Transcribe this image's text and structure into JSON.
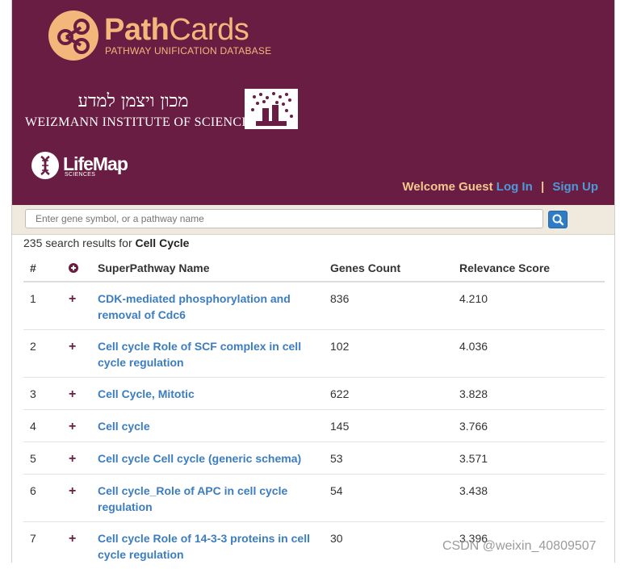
{
  "brand": {
    "name_bold": "Path",
    "name_light": "Cards",
    "subtitle": "PATHWAY UNIFICATION DATABASE",
    "accent_color": "#f3b77c",
    "header_bg": "#6a1d42"
  },
  "institute": {
    "hebrew_name": "מכון ויצמן למדע",
    "english_name": "WEIZMANN INSTITUTE OF SCIENCE"
  },
  "partner": {
    "name": "LifeMap",
    "subtitle": "SCIENCES"
  },
  "account": {
    "welcome": "Welcome Guest",
    "login": "Log In",
    "separator": "|",
    "signup": "Sign Up"
  },
  "search": {
    "placeholder": "Enter gene symbol, or a pathway name",
    "button_icon": "search-icon"
  },
  "results": {
    "prefix": "235 search results for",
    "query": "Cell Cycle",
    "columns": {
      "num": "#",
      "expand_icon": "plus-circle-icon",
      "name": "SuperPathway Name",
      "genes": "Genes Count",
      "score": "Relevance Score"
    },
    "rows": [
      {
        "num": "1",
        "name": "CDK-mediated phosphorylation and removal of Cdc6",
        "genes": "836",
        "score": "4.210"
      },
      {
        "num": "2",
        "name": "Cell cycle Role of SCF complex in cell cycle regulation",
        "genes": "102",
        "score": "4.036"
      },
      {
        "num": "3",
        "name": "Cell Cycle, Mitotic",
        "genes": "622",
        "score": "3.828"
      },
      {
        "num": "4",
        "name": "Cell cycle",
        "genes": "145",
        "score": "3.766"
      },
      {
        "num": "5",
        "name": "Cell cycle Cell cycle (generic schema)",
        "genes": "53",
        "score": "3.571"
      },
      {
        "num": "6",
        "name": "Cell cycle_Role of APC in cell cycle regulation",
        "genes": "54",
        "score": "3.438"
      },
      {
        "num": "7",
        "name": "Cell cycle Role of 14-3-3 proteins in cell cycle regulation",
        "genes": "30",
        "score": "3.396"
      }
    ],
    "expand_glyph": "+"
  },
  "watermark": "CSDN @weixin_40809507"
}
